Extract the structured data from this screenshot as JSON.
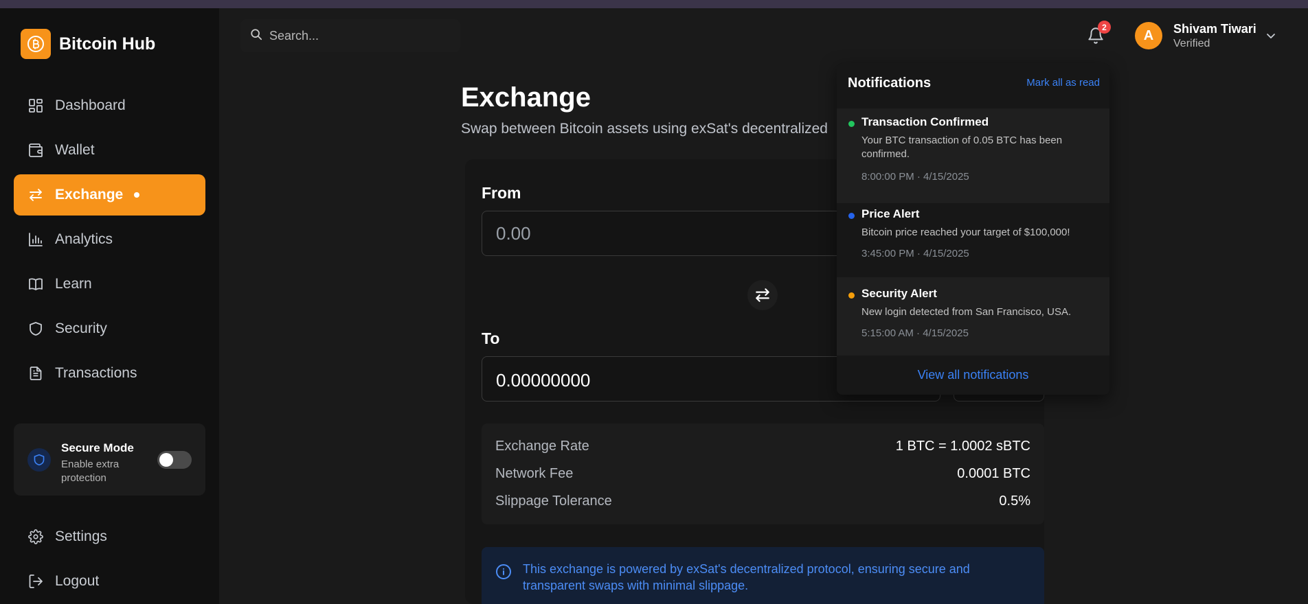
{
  "brand": {
    "name": "Bitcoin Hub"
  },
  "colors": {
    "accent": "#f7931a",
    "link": "#3b82f6",
    "badge": "#ef4444",
    "success": "#22c55e",
    "info": "#2563eb",
    "warning": "#f59e0b"
  },
  "sidebar": {
    "items": [
      {
        "label": "Dashboard",
        "icon": "dashboard-icon"
      },
      {
        "label": "Wallet",
        "icon": "wallet-icon"
      },
      {
        "label": "Exchange",
        "icon": "exchange-icon",
        "active": true
      },
      {
        "label": "Analytics",
        "icon": "analytics-icon"
      },
      {
        "label": "Learn",
        "icon": "book-icon"
      },
      {
        "label": "Security",
        "icon": "shield-icon"
      },
      {
        "label": "Transactions",
        "icon": "document-icon"
      }
    ],
    "secure_mode": {
      "title": "Secure Mode",
      "subtitle": "Enable extra protection",
      "enabled": false
    },
    "bottom": [
      {
        "label": "Settings",
        "icon": "gear-icon"
      },
      {
        "label": "Logout",
        "icon": "logout-icon"
      }
    ]
  },
  "header": {
    "search_placeholder": "Search...",
    "notification_count": "2",
    "user": {
      "avatar_initial": "A",
      "name": "Shivam Tiwari",
      "status": "Verified"
    }
  },
  "main": {
    "title": "Exchange",
    "subtitle": "Swap between Bitcoin assets using exSat's decentralized",
    "from_label": "From",
    "from_placeholder": "0.00",
    "to_label": "To",
    "to_value": "0.00000000",
    "info": [
      {
        "key": "Exchange Rate",
        "value": "1 BTC = 1.0002 sBTC"
      },
      {
        "key": "Network Fee",
        "value": "0.0001 BTC"
      },
      {
        "key": "Slippage Tolerance",
        "value": "0.5%"
      }
    ],
    "notice": "This exchange is powered by exSat's decentralized protocol, ensuring secure and transparent swaps with minimal slippage."
  },
  "notifications": {
    "title": "Notifications",
    "mark_all": "Mark all as read",
    "items": [
      {
        "title": "Transaction Confirmed",
        "message": "Your BTC transaction of 0.05 BTC has been confirmed.",
        "time": "8:00:00 PM · 4/15/2025",
        "dot_color": "#22c55e"
      },
      {
        "title": "Price Alert",
        "message": "Bitcoin price reached your target of $100,000!",
        "time": "3:45:00 PM · 4/15/2025",
        "dot_color": "#2563eb"
      },
      {
        "title": "Security Alert",
        "message": "New login detected from San Francisco, USA.",
        "time": "5:15:00 AM · 4/15/2025",
        "dot_color": "#f59e0b"
      }
    ],
    "view_all": "View all notifications"
  }
}
